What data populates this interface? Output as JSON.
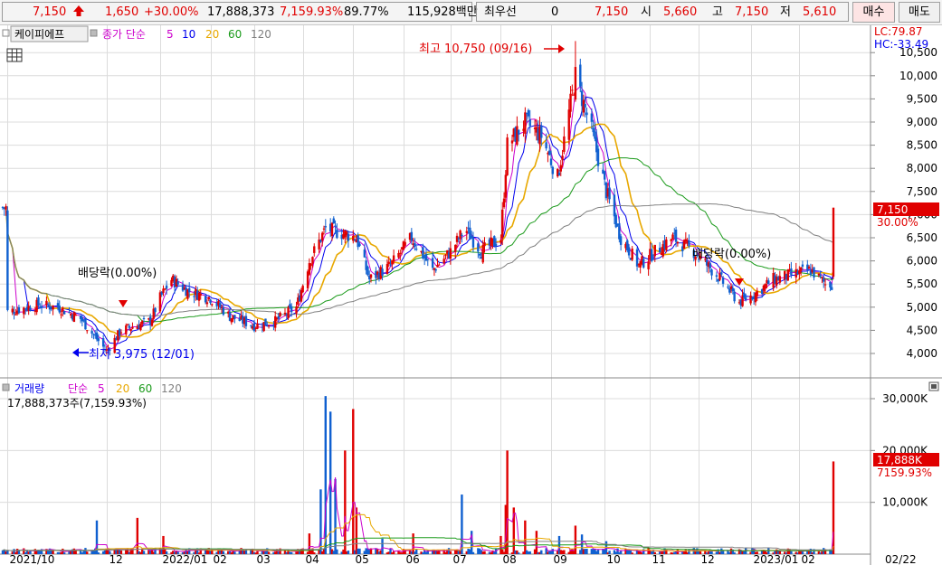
{
  "quote_bar": {
    "price": "7,150",
    "change": "1,650",
    "change_pct": "+30.00%",
    "volume": "17,888,373",
    "volume_ratio": "7,159.93%",
    "turnover_pct": "89.77%",
    "amount": "115,928백만",
    "pref_label": "최우선",
    "pref_value": "0",
    "pref_price": "7,150",
    "open_label": "시",
    "open_value": "5,660",
    "high_label": "고",
    "high_value": "7,150",
    "low_label": "저",
    "low_value": "5,610",
    "buy_button": "매수",
    "sell_button": "매도"
  },
  "colors": {
    "up": "#e00000",
    "down": "#1060d0",
    "ma5": "#cc00cc",
    "ma10": "#0000ee",
    "ma20": "#e8a800",
    "ma60": "#1a9a1a",
    "ma120": "#808080",
    "vol_ma5": "#cc00cc",
    "vol_ma20": "#e8a800",
    "vol_ma60": "#1a9a1a",
    "vol_ma120": "#808080"
  },
  "price_panel": {
    "stock_name": "케이피에프",
    "legend_title": "종가 단순",
    "legend_periods": [
      "5",
      "10",
      "20",
      "60",
      "120"
    ],
    "lc_label": "LC:79.87",
    "hc_label": "HC:-33.49",
    "last_price_tag": "7,150",
    "last_pct_tag": "30.00%",
    "high_annotation": "최고 10,750 (09/16)",
    "low_annotation": "최저 3,975 (12/01)",
    "dividend_1": "배당락(0.00%)",
    "dividend_2": "배당락(0.00%)",
    "y_ticks": [
      "4,000",
      "4,500",
      "5,000",
      "5,500",
      "6,000",
      "6,500",
      "7,000",
      "7,500",
      "8,000",
      "8,500",
      "9,000",
      "9,500",
      "10,000",
      "10,500"
    ]
  },
  "volume_panel": {
    "legend_title": "거래량",
    "legend_sub": "단순",
    "legend_periods": [
      "5",
      "20",
      "60",
      "120"
    ],
    "current_label": "17,888,373주(7,159.93%)",
    "vol_tag": "17,888K",
    "vol_pct_tag": "7159.93%",
    "y_ticks": [
      "10,000K",
      "20,000K",
      "30,000K"
    ]
  },
  "x_axis": {
    "labels": [
      "2021/10",
      "12",
      "2022/01",
      "02",
      "03",
      "04",
      "05",
      "06",
      "07",
      "08",
      "09",
      "10",
      "11",
      "12",
      "2023/01",
      "02"
    ],
    "right_label": "02/22"
  },
  "chart_data": {
    "type": "candlestick",
    "title": "케이피에프",
    "ylabel": "",
    "ylim": [
      3700,
      10800
    ],
    "close_anchors": [
      {
        "d": "2021/10/01",
        "c": 4900
      },
      {
        "d": "2021/10/20",
        "c": 5050
      },
      {
        "d": "2021/11/01",
        "c": 5000
      },
      {
        "d": "2021/11/15",
        "c": 4750
      },
      {
        "d": "2021/12/01",
        "c": 4050
      },
      {
        "d": "2021/12/10",
        "c": 4500
      },
      {
        "d": "2021/12/28",
        "c": 4700
      },
      {
        "d": "2022/01/03",
        "c": 5200
      },
      {
        "d": "2022/01/10",
        "c": 5600
      },
      {
        "d": "2022/01/20",
        "c": 5350
      },
      {
        "d": "2022/02/03",
        "c": 5200
      },
      {
        "d": "2022/02/15",
        "c": 4800
      },
      {
        "d": "2022/03/02",
        "c": 4600
      },
      {
        "d": "2022/03/15",
        "c": 4700
      },
      {
        "d": "2022/03/28",
        "c": 5000
      },
      {
        "d": "2022/04/05",
        "c": 6000
      },
      {
        "d": "2022/04/15",
        "c": 6700
      },
      {
        "d": "2022/04/25",
        "c": 6600
      },
      {
        "d": "2022/05/04",
        "c": 6500
      },
      {
        "d": "2022/05/12",
        "c": 5600
      },
      {
        "d": "2022/05/25",
        "c": 5900
      },
      {
        "d": "2022/06/07",
        "c": 6500
      },
      {
        "d": "2022/06/20",
        "c": 5800
      },
      {
        "d": "2022/07/01",
        "c": 6200
      },
      {
        "d": "2022/07/10",
        "c": 6700
      },
      {
        "d": "2022/07/20",
        "c": 6200
      },
      {
        "d": "2022/08/01",
        "c": 6500
      },
      {
        "d": "2022/08/05",
        "c": 8500
      },
      {
        "d": "2022/08/16",
        "c": 9000
      },
      {
        "d": "2022/08/26",
        "c": 8700
      },
      {
        "d": "2022/09/05",
        "c": 7800
      },
      {
        "d": "2022/09/16",
        "c": 10000
      },
      {
        "d": "2022/09/26",
        "c": 8800
      },
      {
        "d": "2022/10/05",
        "c": 7500
      },
      {
        "d": "2022/10/14",
        "c": 6500
      },
      {
        "d": "2022/10/25",
        "c": 5900
      },
      {
        "d": "2022/11/04",
        "c": 6200
      },
      {
        "d": "2022/11/15",
        "c": 6500
      },
      {
        "d": "2022/11/28",
        "c": 6200
      },
      {
        "d": "2022/12/12",
        "c": 5700
      },
      {
        "d": "2022/12/26",
        "c": 5100
      },
      {
        "d": "2023/01/05",
        "c": 5300
      },
      {
        "d": "2023/01/16",
        "c": 5600
      },
      {
        "d": "2023/01/27",
        "c": 5700
      },
      {
        "d": "2023/02/08",
        "c": 5800
      },
      {
        "d": "2023/02/17",
        "c": 5500
      },
      {
        "d": "2023/02/21",
        "c": 5500
      },
      {
        "d": "2023/02/22",
        "c": 7150
      }
    ],
    "high": {
      "date": "2022/09/16",
      "value": 10750
    },
    "low": {
      "date": "2021/12/01",
      "value": 3975
    },
    "last": {
      "date": "2023/02/22",
      "open": 5660,
      "high": 7150,
      "low": 5610,
      "close": 7150,
      "volume": 17888373
    },
    "volume_spikes_k": [
      {
        "d": "2021/10/05",
        "v": 1000
      },
      {
        "d": "2021/11/25",
        "v": 6500
      },
      {
        "d": "2021/12/20",
        "v": 7000
      },
      {
        "d": "2022/01/05",
        "v": 3500
      },
      {
        "d": "2022/03/20",
        "v": 2000
      },
      {
        "d": "2022/04/05",
        "v": 4000
      },
      {
        "d": "2022/04/12",
        "v": 12500
      },
      {
        "d": "2022/04/15",
        "v": 30500
      },
      {
        "d": "2022/04/18",
        "v": 27500
      },
      {
        "d": "2022/04/21",
        "v": 14500
      },
      {
        "d": "2022/04/27",
        "v": 20000
      },
      {
        "d": "2022/05/02",
        "v": 28000
      },
      {
        "d": "2022/05/04",
        "v": 9000
      },
      {
        "d": "2022/05/20",
        "v": 3000
      },
      {
        "d": "2022/06/08",
        "v": 4000
      },
      {
        "d": "2022/07/08",
        "v": 11500
      },
      {
        "d": "2022/07/14",
        "v": 4500
      },
      {
        "d": "2022/08/01",
        "v": 3500
      },
      {
        "d": "2022/08/04",
        "v": 9500
      },
      {
        "d": "2022/08/05",
        "v": 20000
      },
      {
        "d": "2022/08/09",
        "v": 9000
      },
      {
        "d": "2022/08/16",
        "v": 6500
      },
      {
        "d": "2022/08/23",
        "v": 4500
      },
      {
        "d": "2022/09/06",
        "v": 3500
      },
      {
        "d": "2022/09/16",
        "v": 5500
      },
      {
        "d": "2022/09/20",
        "v": 3800
      },
      {
        "d": "2022/10/05",
        "v": 2500
      },
      {
        "d": "2023/02/22",
        "v": 17888
      }
    ],
    "volume_ylim_k": [
      0,
      33000
    ]
  }
}
